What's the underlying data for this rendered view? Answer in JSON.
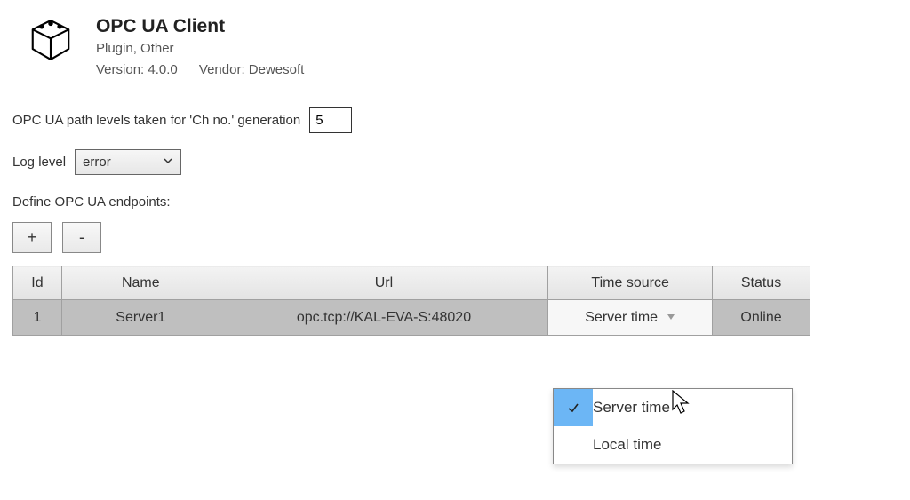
{
  "header": {
    "title": "OPC UA Client",
    "subtitle": "Plugin, Other",
    "version_label": "Version: 4.0.0",
    "vendor_label": "Vendor: Dewesoft"
  },
  "path_levels": {
    "label": "OPC UA path levels taken for 'Ch no.' generation",
    "value": "5"
  },
  "log_level": {
    "label": "Log level",
    "selected": "error"
  },
  "endpoints_section_label": "Define OPC UA endpoints:",
  "buttons": {
    "add": "+",
    "remove": "-"
  },
  "table": {
    "columns": {
      "id": "Id",
      "name": "Name",
      "url": "Url",
      "time_source": "Time source",
      "status": "Status"
    },
    "rows": [
      {
        "id": "1",
        "name": "Server1",
        "url": "opc.tcp://KAL-EVA-S:48020",
        "time_source": "Server time",
        "status": "Online"
      }
    ]
  },
  "time_source_dropdown": {
    "options": [
      "Server time",
      "Local time"
    ],
    "selected_index": 0
  }
}
